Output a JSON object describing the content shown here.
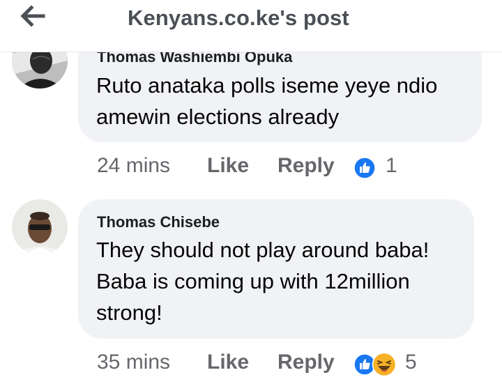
{
  "header": {
    "title": "Kenyans.co.ke's post",
    "back_icon": "arrow-left-icon"
  },
  "colors": {
    "bubble": "#f0f2f5",
    "meta_text": "#65676b",
    "like_blue": "#1877f2",
    "haha_yellow": "#f7b125"
  },
  "comments": [
    {
      "author": "Thomas Washiembi Opuka",
      "lines": [
        "Ruto anataka polls iseme yeye ndio",
        "amewin elections already"
      ],
      "time": "24 mins",
      "like_label": "Like",
      "reply_label": "Reply",
      "reactions": [
        "like-icon"
      ],
      "reaction_count": "1"
    },
    {
      "author": "Thomas Chisebe",
      "lines": [
        "They should not play around baba!",
        "Baba is coming up with 12million",
        "strong!"
      ],
      "time": "35 mins",
      "like_label": "Like",
      "reply_label": "Reply",
      "reactions": [
        "like-icon",
        "haha-icon"
      ],
      "reaction_count": "5"
    }
  ]
}
